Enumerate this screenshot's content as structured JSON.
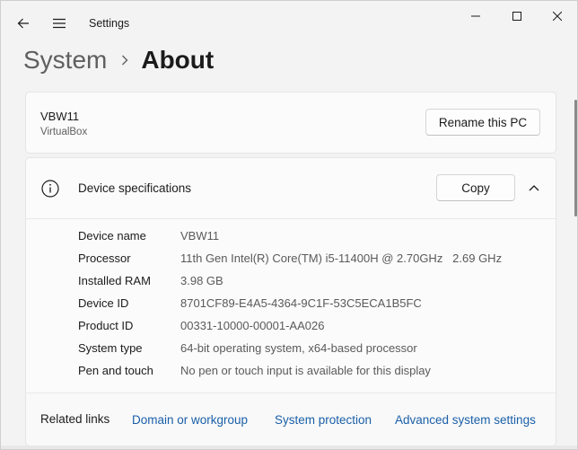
{
  "window": {
    "title": "Settings",
    "icons": {
      "back": "back-arrow-icon",
      "menu": "hamburger-menu-icon",
      "minimize": "minimize-icon",
      "maximize": "maximize-icon",
      "close": "close-icon"
    }
  },
  "breadcrumb": {
    "parent": "System",
    "current": "About"
  },
  "pc": {
    "name": "VBW11",
    "model": "VirtualBox",
    "rename_label": "Rename this PC"
  },
  "specs": {
    "title": "Device specifications",
    "copy_label": "Copy",
    "rows": [
      {
        "label": "Device name",
        "value": "VBW11"
      },
      {
        "label": "Processor",
        "value": "11th Gen Intel(R) Core(TM) i5-11400H @ 2.70GHz   2.69 GHz"
      },
      {
        "label": "Installed RAM",
        "value": "3.98 GB"
      },
      {
        "label": "Device ID",
        "value": "8701CF89-E4A5-4364-9C1F-53C5ECA1B5FC"
      },
      {
        "label": "Product ID",
        "value": "00331-10000-00001-AA026"
      },
      {
        "label": "System type",
        "value": "64-bit operating system, x64-based processor"
      },
      {
        "label": "Pen and touch",
        "value": "No pen or touch input is available for this display"
      }
    ]
  },
  "related": {
    "label": "Related links",
    "links": [
      "Domain or workgroup",
      "System protection",
      "Advanced system settings"
    ]
  },
  "colors": {
    "accent_link": "#1a5fa8",
    "background": "#f3f3f3",
    "card": "#fbfbfb"
  }
}
